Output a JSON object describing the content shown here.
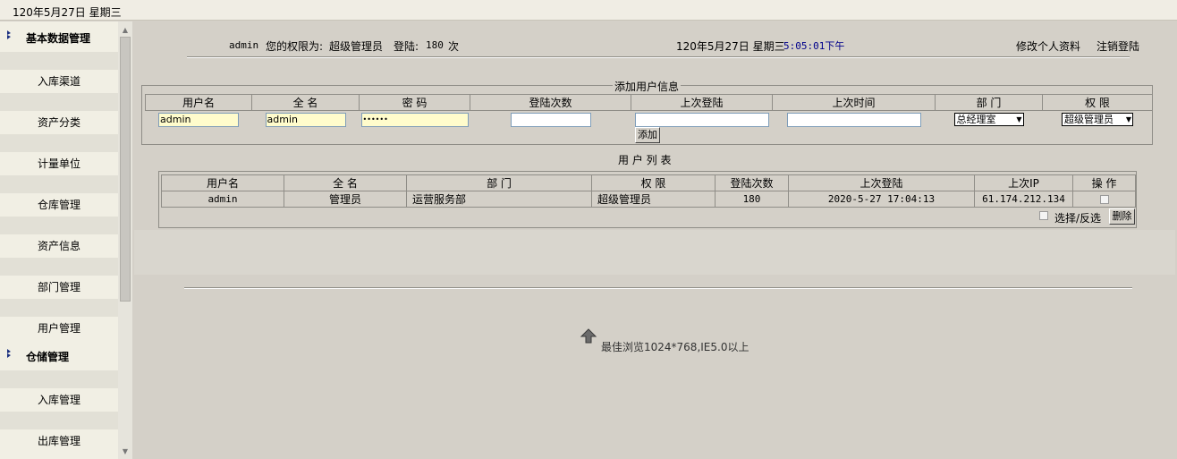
{
  "top": {
    "date": "120年5月27日 星期三"
  },
  "sidebar": {
    "sections": [
      {
        "title": "基本数据管理",
        "items": [
          "入库渠道",
          "资产分类",
          "计量单位",
          "仓库管理",
          "资产信息",
          "部门管理",
          "用户管理"
        ]
      },
      {
        "title": "仓储管理",
        "items": [
          "入库管理",
          "出库管理"
        ]
      }
    ]
  },
  "header": {
    "user": "admin",
    "permission_text": "您的权限为:",
    "role": "超级管理员",
    "login_text": "登陆:",
    "login_count": "180",
    "count_unit": "次",
    "date": "120年5月27日 星期三",
    "time": "5:05:01下午",
    "edit_profile": "修改个人资料",
    "logout": "注销登陆"
  },
  "add_user": {
    "legend": "添加用户信息",
    "columns": [
      "用户名",
      "全 名",
      "密 码",
      "登陆次数",
      "上次登陆",
      "上次时间",
      "部 门",
      "权 限"
    ],
    "username_value": "admin",
    "fullname_value": "admin",
    "password_value": "••••••",
    "department_value": "总经理室",
    "role_value": "超级管理员",
    "add_button": "添加"
  },
  "user_list": {
    "title": "用 户 列 表",
    "columns": [
      "用户名",
      "全 名",
      "部 门",
      "权 限",
      "登陆次数",
      "上次登陆",
      "上次IP",
      "操 作"
    ],
    "rows": [
      {
        "username": "admin",
        "fullname": "管理员",
        "department": "运营服务部",
        "role": "超级管理员",
        "login_count": "180",
        "last_login": "2020-5-27 17:04:13",
        "last_ip": "61.174.212.134"
      }
    ],
    "select_toggle": "选择/反选",
    "delete_button": "删除"
  },
  "footer": {
    "tip": "最佳浏览1024*768,IE5.0以上"
  },
  "colors": {
    "time": "#00008b",
    "background": "#d4d0c8",
    "sidebar": "#f1efe4"
  }
}
